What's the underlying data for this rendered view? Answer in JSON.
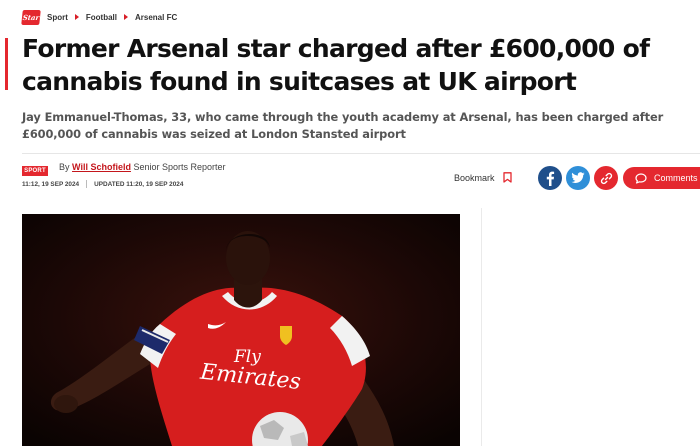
{
  "breadcrumb": {
    "logo_text": "Star",
    "items": [
      "Sport",
      "Football",
      "Arsenal FC"
    ]
  },
  "article": {
    "headline": "Former Arsenal star charged after £600,000 of cannabis found in suitcases at UK airport",
    "standfirst": "Jay Emmanuel-Thomas, 33, who came through the youth academy at Arsenal, has been charged after £600,000 of cannabis was seized at London Stansted airport"
  },
  "byline": {
    "section_badge": "SPORT",
    "by": "By",
    "author": "Will Schofield",
    "role": "Senior Sports Reporter",
    "published": "11:12, 19 SEP 2024",
    "updated": "UPDATED 11:20, 19 SEP 2024"
  },
  "actions": {
    "bookmark_label": "Bookmark",
    "bookmark_icon": "bookmark-icon",
    "share_icons": [
      "facebook-icon",
      "twitter-icon",
      "link-icon"
    ],
    "comments_label": "Comments"
  },
  "hero_image": {
    "shirt_text_line1": "Fly",
    "shirt_text_line2": "Emirates"
  },
  "colors": {
    "brand_red": "#e4282f",
    "facebook_blue": "#1f4f8b",
    "twitter_blue": "#2f8fd8"
  }
}
